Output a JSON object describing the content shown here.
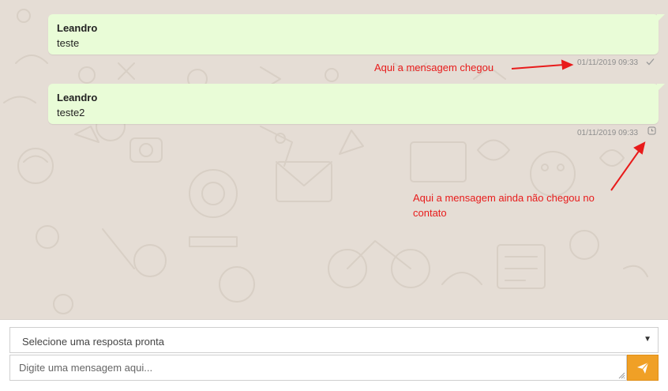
{
  "messages": [
    {
      "sender": "Leandro",
      "text": "teste",
      "timestamp": "01/11/2019 09:33",
      "status": "sent",
      "status_icon": "check-icon"
    },
    {
      "sender": "Leandro",
      "text": "teste2",
      "timestamp": "01/11/2019 09:33",
      "status": "pending",
      "status_icon": "clock-icon"
    }
  ],
  "annotations": {
    "arrived": "Aqui a mensagem chegou",
    "not_arrived": "Aqui a mensagem ainda não chegou no contato"
  },
  "quick_reply": {
    "selected": "Selecione uma resposta pronta",
    "caret_icon": "caret-down-icon"
  },
  "composer": {
    "placeholder": "Digite uma mensagem aqui...",
    "send_icon": "paper-plane-icon"
  },
  "colors": {
    "chat_background": "#e5ddd5",
    "bubble": "#e9fcd7",
    "annotation": "#e81b1b",
    "send_button": "#f0a026"
  }
}
